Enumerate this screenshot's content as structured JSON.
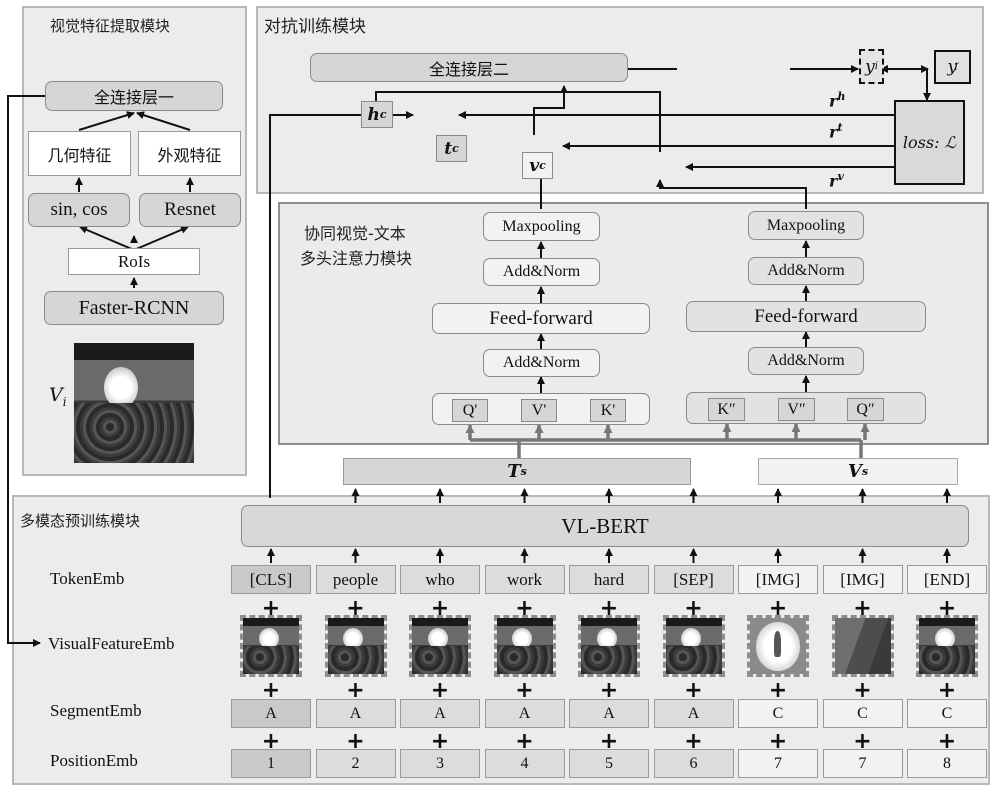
{
  "visual_module": {
    "title": "视觉特征提取模块",
    "fc1": "全连接层一",
    "geometry": "几何特征",
    "appearance": "外观特征",
    "sincos": "sin, cos",
    "resnet": "Resnet",
    "rois": "RoIs",
    "faster_rcnn": "Faster-RCNN",
    "image_label": "V",
    "image_label_sub": "i"
  },
  "adversarial_module": {
    "title": "对抗训练模块",
    "fc2": "全连接层二",
    "hc": "h",
    "hc_sup": "c",
    "tc": "t",
    "tc_sup": "c",
    "vc": "v",
    "vc_sup": "c",
    "y_pred": "y",
    "y_pred_sub": "i",
    "y_true": "y",
    "y_true_sup": "′",
    "y_true_sub": "i",
    "loss": "loss: ℒ",
    "rh": "r",
    "rh_sup": "h",
    "rt": "r",
    "rt_sup": "t",
    "rv": "r",
    "rv_sup": "v"
  },
  "coattention_module": {
    "title_line1": "协同视觉-文本",
    "title_line2": "多头注意力模块",
    "left": {
      "maxpool": "Maxpooling",
      "addnorm_top": "Add&Norm",
      "ff": "Feed-forward",
      "addnorm_bottom": "Add&Norm",
      "q": "Q'",
      "v": "V'",
      "k": "K'"
    },
    "right": {
      "maxpool": "Maxpooling",
      "addnorm_top": "Add&Norm",
      "ff": "Feed-forward",
      "addnorm_bottom": "Add&Norm",
      "k": "K″",
      "v": "V″",
      "q": "Q″"
    },
    "ts": "T",
    "ts_sup": "s",
    "vs": "V",
    "vs_sup": "s"
  },
  "pretrain_module": {
    "title": "多模态预训练模块",
    "vlbert": "VL-BERT",
    "row_labels": {
      "token": "TokenEmb",
      "visual": "VisualFeatureEmb",
      "segment": "SegmentEmb",
      "position": "PositionEmb"
    },
    "tokens": [
      "[CLS]",
      "people",
      "who",
      "work",
      "hard",
      "[SEP]",
      "[IMG]",
      "[IMG]",
      "[END]"
    ],
    "segments": [
      "A",
      "A",
      "A",
      "A",
      "A",
      "A",
      "C",
      "C",
      "C"
    ],
    "positions": [
      "1",
      "2",
      "3",
      "4",
      "5",
      "6",
      "7",
      "7",
      "8"
    ],
    "plus": "+"
  }
}
